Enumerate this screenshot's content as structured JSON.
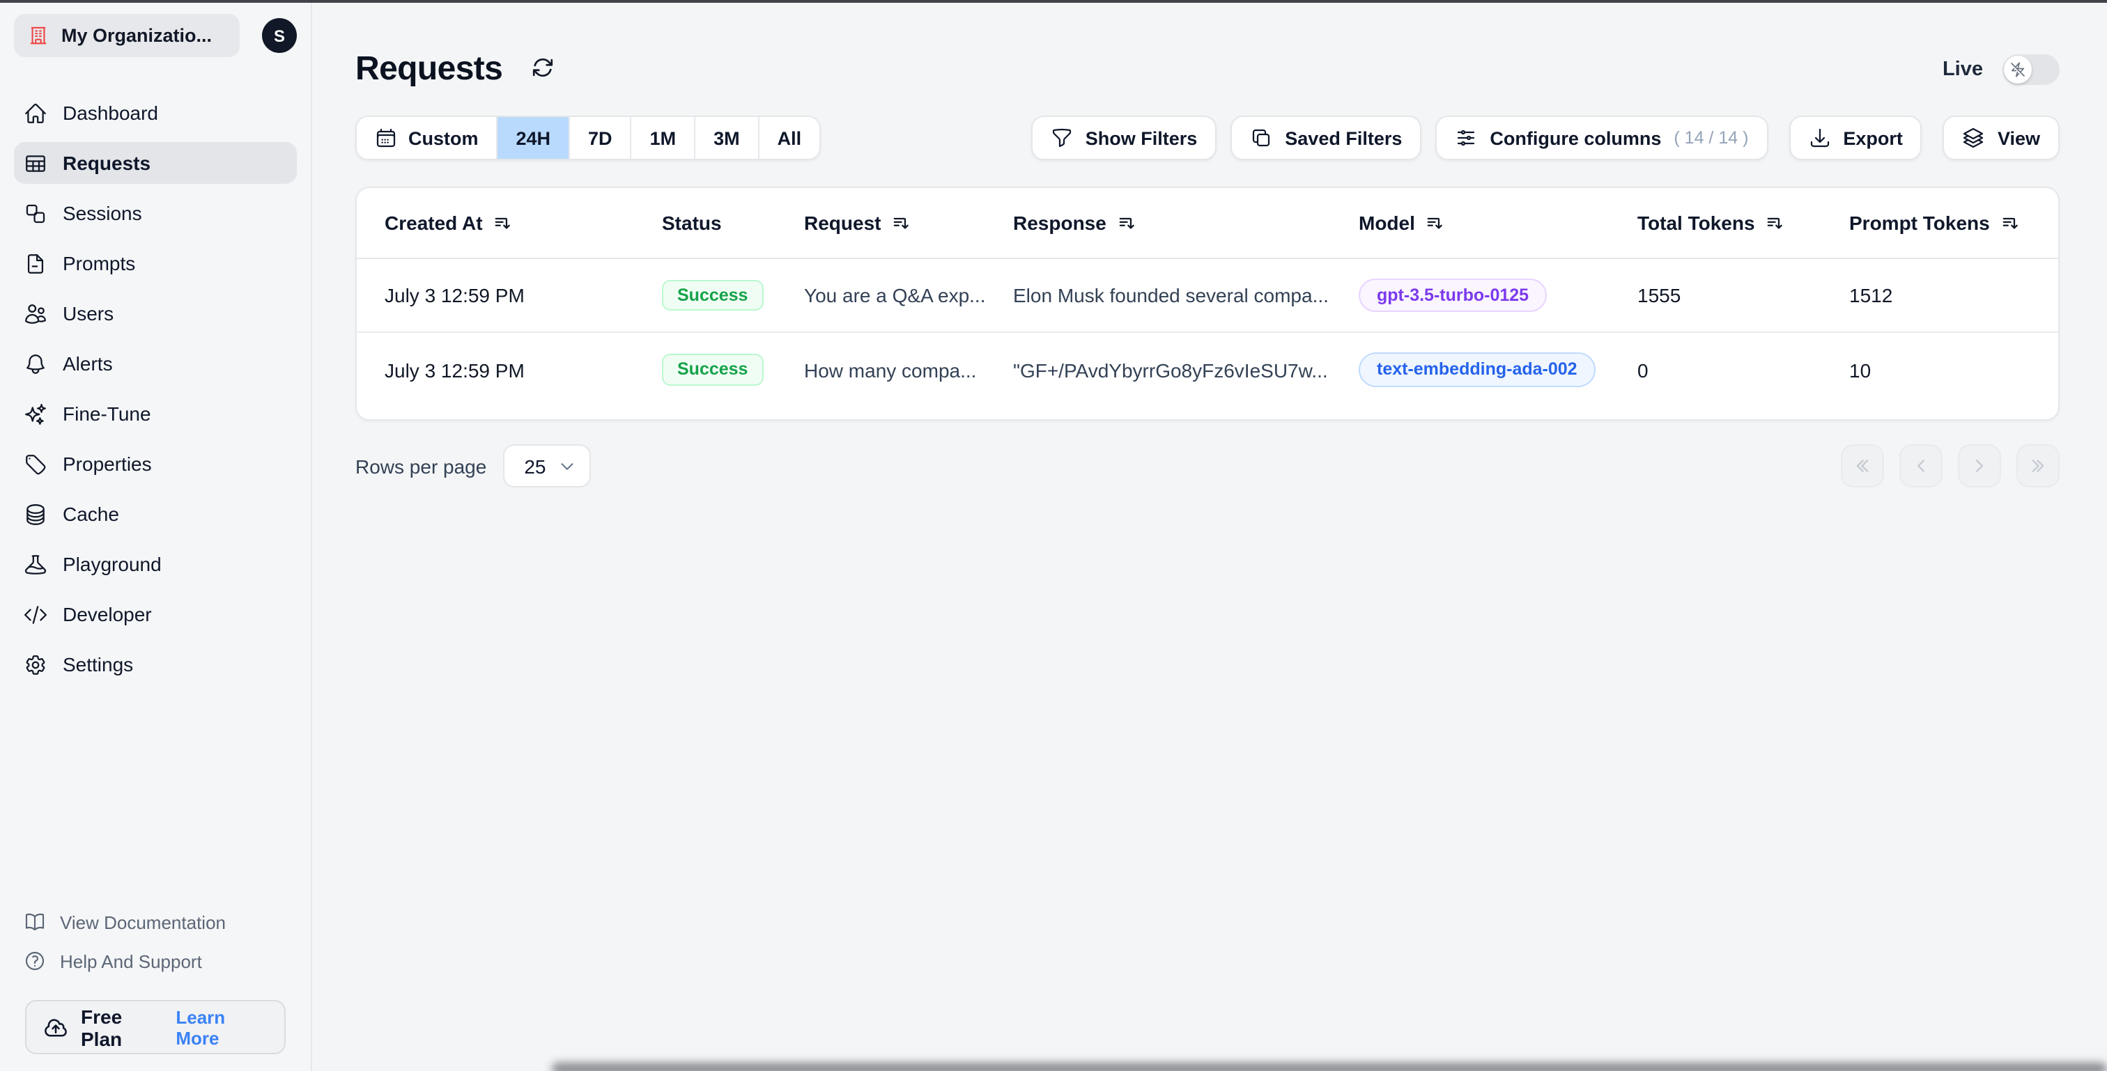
{
  "org": {
    "name": "My Organizatio...",
    "avatar_initial": "S"
  },
  "sidebar": {
    "items": [
      {
        "label": "Dashboard",
        "icon": "home-icon"
      },
      {
        "label": "Requests",
        "icon": "table-icon",
        "active": true
      },
      {
        "label": "Sessions",
        "icon": "sessions-icon"
      },
      {
        "label": "Prompts",
        "icon": "document-icon"
      },
      {
        "label": "Users",
        "icon": "users-icon"
      },
      {
        "label": "Alerts",
        "icon": "bell-icon"
      },
      {
        "label": "Fine-Tune",
        "icon": "sparkles-icon"
      },
      {
        "label": "Properties",
        "icon": "tag-icon"
      },
      {
        "label": "Cache",
        "icon": "database-icon"
      },
      {
        "label": "Playground",
        "icon": "beaker-icon"
      },
      {
        "label": "Developer",
        "icon": "code-icon"
      },
      {
        "label": "Settings",
        "icon": "gear-icon"
      }
    ],
    "footer_items": [
      {
        "label": "View Documentation",
        "icon": "book-open-icon"
      },
      {
        "label": "Help And Support",
        "icon": "question-circle-icon"
      }
    ],
    "plan": {
      "label": "Free Plan",
      "link": "Learn More",
      "icon": "cloud-upload-icon"
    }
  },
  "header": {
    "title": "Requests",
    "live_label": "Live",
    "live_on": false
  },
  "toolbar": {
    "time_ranges": [
      "Custom",
      "24H",
      "7D",
      "1M",
      "3M",
      "All"
    ],
    "selected_range": "24H",
    "show_filters": "Show Filters",
    "saved_filters": "Saved Filters",
    "configure_columns": "Configure columns",
    "configure_columns_count": "( 14 / 14 )",
    "export": "Export",
    "view": "View"
  },
  "table": {
    "columns": [
      {
        "label": "Created At",
        "sortable": true
      },
      {
        "label": "Status",
        "sortable": false
      },
      {
        "label": "Request",
        "sortable": true
      },
      {
        "label": "Response",
        "sortable": true
      },
      {
        "label": "Model",
        "sortable": true
      },
      {
        "label": "Total Tokens",
        "sortable": true
      },
      {
        "label": "Prompt Tokens",
        "sortable": true
      }
    ],
    "rows": [
      {
        "created_at": "July 3 12:59 PM",
        "status": "Success",
        "request": "You are a Q&A exp...",
        "response": "Elon Musk founded several compa...",
        "model": "gpt-3.5-turbo-0125",
        "model_color": "purple",
        "total_tokens": "1555",
        "prompt_tokens": "1512"
      },
      {
        "created_at": "July 3 12:59 PM",
        "status": "Success",
        "request": "How many compa...",
        "response": "\"GF+/PAvdYbyrrGo8yFz6vIeSU7w...",
        "model": "text-embedding-ada-002",
        "model_color": "blue",
        "total_tokens": "0",
        "prompt_tokens": "10"
      }
    ]
  },
  "pagination": {
    "rows_per_page_label": "Rows per page",
    "rows_per_page_value": "25"
  },
  "colors": {
    "success_text": "#16a34a",
    "success_bg": "#f0fdf4",
    "success_border": "#bbf7d0",
    "model_purple": "#7c3aed",
    "model_blue": "#2563eb",
    "selected_range_bg": "#b9dafd",
    "org_icon_red": "#ef4444",
    "link_blue": "#3b82f6",
    "avatar_bg": "#111827",
    "page_bg": "#f4f5f6"
  }
}
